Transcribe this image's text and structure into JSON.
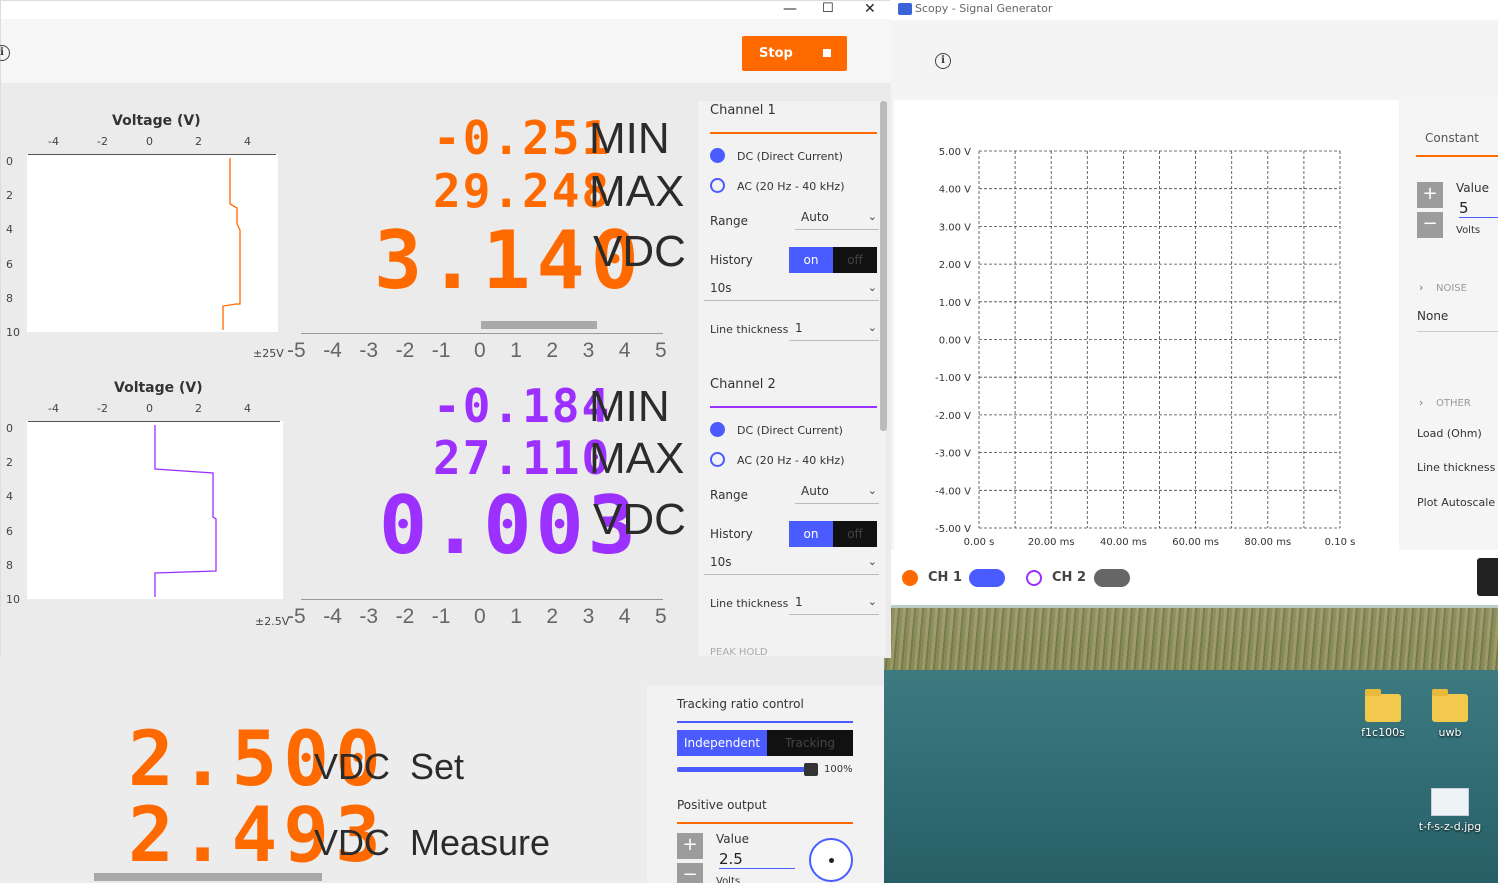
{
  "left_window": {
    "window_controls": {
      "minimize": "—",
      "maximize": "☐",
      "close": "✕"
    },
    "stop_button": "Stop",
    "ch1": {
      "plot_title": "Voltage (V)",
      "x_ticks": [
        "-4",
        "-2",
        "0",
        "2",
        "4"
      ],
      "y_ticks": [
        "0",
        "2",
        "4",
        "6",
        "8",
        "10"
      ],
      "min_value": "-0.251",
      "min_label": "MIN",
      "max_value": "29.248",
      "max_label": "MAX",
      "main_value": "3.140",
      "main_unit": "VDC",
      "range_label": "±25V",
      "scale_ticks": [
        "-5",
        "-4",
        "-3",
        "-2",
        "-1",
        "0",
        "1",
        "2",
        "3",
        "4",
        "5"
      ],
      "color": "#ff6a00"
    },
    "ch2": {
      "plot_title": "Voltage (V)",
      "x_ticks": [
        "-4",
        "-2",
        "0",
        "2",
        "4"
      ],
      "y_ticks": [
        "0",
        "2",
        "4",
        "6",
        "8",
        "10"
      ],
      "min_value": "-0.184",
      "min_label": "MIN",
      "max_value": "27.110",
      "max_label": "MAX",
      "main_value": "0.003",
      "main_unit": "VDC",
      "range_label": "±2.5V",
      "scale_ticks": [
        "-5",
        "-4",
        "-3",
        "-2",
        "-1",
        "0",
        "1",
        "2",
        "3",
        "4",
        "5"
      ],
      "color": "#9b30ff"
    },
    "side": {
      "ch1_title": "Channel 1",
      "ch2_title": "Channel 2",
      "dc_label": "DC (Direct Current)",
      "ac_label": "AC (20 Hz - 40 kHz)",
      "range_label": "Range",
      "range_value": "Auto",
      "history_label": "History",
      "history_on": "on",
      "history_off": "off",
      "history_window": "10s",
      "thickness_label": "Line thickness",
      "thickness_value": "1",
      "peak_hold": "PEAK HOLD"
    }
  },
  "bottom_window": {
    "set_value": "2.500",
    "set_unit": "VDC",
    "set_label": "Set",
    "measure_value": "2.493",
    "measure_unit": "VDC",
    "measure_label": "Measure",
    "tracking_title": "Tracking ratio control",
    "independent": "Independent",
    "tracking": "Tracking",
    "ratio": "100%",
    "positive_output": "Positive output",
    "value_label": "Value",
    "value": "2.5",
    "volts": "Volts"
  },
  "right_window": {
    "title": "Scopy - Signal Generator",
    "y_ticks": [
      "5.00 V",
      "4.00 V",
      "3.00 V",
      "2.00 V",
      "1.00 V",
      "0.00 V",
      "-1.00 V",
      "-2.00 V",
      "-3.00 V",
      "-4.00 V",
      "-5.00 V"
    ],
    "x_ticks": [
      "0.00 s",
      "20.00 ms",
      "40.00 ms",
      "60.00 ms",
      "80.00 ms",
      "0.10 s"
    ],
    "side": {
      "tab": "Constant",
      "value_label": "Value",
      "value": "5",
      "unit": "Volts",
      "noise_label": "NOISE",
      "noise_value": "None",
      "other_label": "OTHER",
      "load_label": "Load (Ohm)",
      "thickness_label": "Line thickness",
      "autoscale_label": "Plot Autoscale"
    },
    "ch1_label": "CH 1",
    "ch2_label": "CH 2"
  },
  "desktop": {
    "icons": [
      {
        "label": "f1c100s"
      },
      {
        "label": "uwb"
      },
      {
        "label": "t-f-s-z-d.jpg"
      }
    ]
  }
}
